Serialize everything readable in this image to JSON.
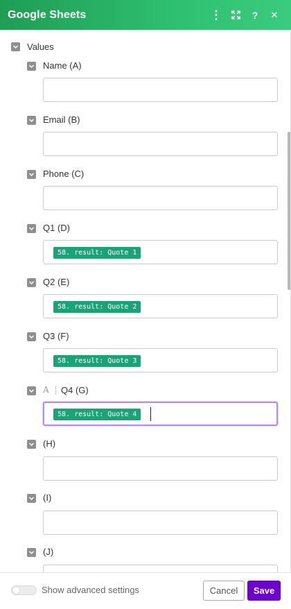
{
  "header": {
    "title": "Google Sheets",
    "icons": [
      "more-icon",
      "expand-icon",
      "help-icon",
      "close-icon"
    ],
    "menu_glyph": "⋮",
    "help_glyph": "?",
    "close_glyph": "✕"
  },
  "values_group": {
    "label": "Values"
  },
  "fields": [
    {
      "label": "Name (A)",
      "value": ""
    },
    {
      "label": "Email (B)",
      "value": ""
    },
    {
      "label": "Phone (C)",
      "value": ""
    },
    {
      "label": "Q1 (D)",
      "value": "58. result: Quote 1"
    },
    {
      "label": "Q2 (E)",
      "value": "58. result: Quote 2"
    },
    {
      "label": "Q3 (F)",
      "value": "58. result: Quote 3"
    },
    {
      "label": "Q4 (G)",
      "value": "58. result: Quote 4",
      "type_tag": "A",
      "focused": true
    },
    {
      "label": "(H)",
      "value": ""
    },
    {
      "label": "(I)",
      "value": ""
    },
    {
      "label": "(J)",
      "value": ""
    }
  ],
  "footer": {
    "toggle_label": "Show advanced settings",
    "cancel_label": "Cancel",
    "save_label": "Save"
  },
  "colors": {
    "header_green": "#2fbf71",
    "pill_green": "#1aa377",
    "save_purple": "#6d00cc",
    "focus_border": "#b48cf0"
  }
}
